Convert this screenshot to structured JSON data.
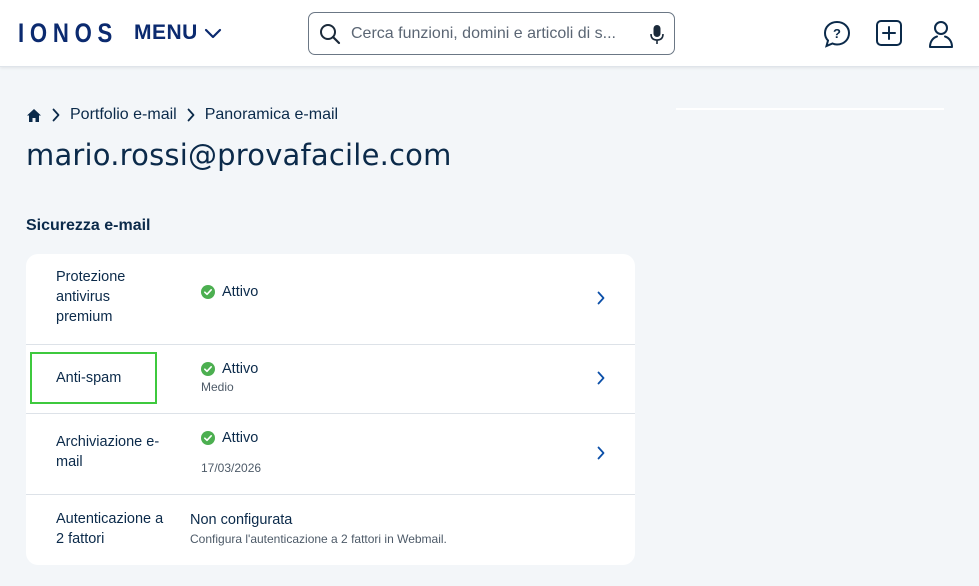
{
  "header": {
    "logo": "IONOS",
    "menu_label": "MENU",
    "search_placeholder": "Cerca funzioni, domini e articoli di s...",
    "icons": [
      "search-icon",
      "microphone-icon",
      "help-chat-icon",
      "add-square-icon",
      "user-icon"
    ]
  },
  "breadcrumb": {
    "home_icon": "home-icon",
    "items": [
      "Portfolio e-mail",
      "Panoramica e-mail"
    ]
  },
  "page": {
    "title": "mario.rossi@provafacile.com",
    "section_title": "Sicurezza e-mail"
  },
  "colors": {
    "brand": "#0b2a6f",
    "text": "#0b2a4a",
    "status_active": "#4caf50",
    "highlight": "#3ec93e",
    "background": "#f3f6f9"
  },
  "security": {
    "rows": [
      {
        "label": "Protezione antivirus premium",
        "status": "Attivo",
        "detail": ""
      },
      {
        "label": "Anti-spam",
        "status": "Attivo",
        "detail": "Medio"
      },
      {
        "label": "Archiviazione e-mail",
        "status": "Attivo",
        "detail": "17/03/2026"
      },
      {
        "label": "Autenticazione a 2 fattori",
        "status": "Non configurata",
        "detail": "Configura l'autenticazione a 2 fattori in Webmail."
      }
    ]
  }
}
